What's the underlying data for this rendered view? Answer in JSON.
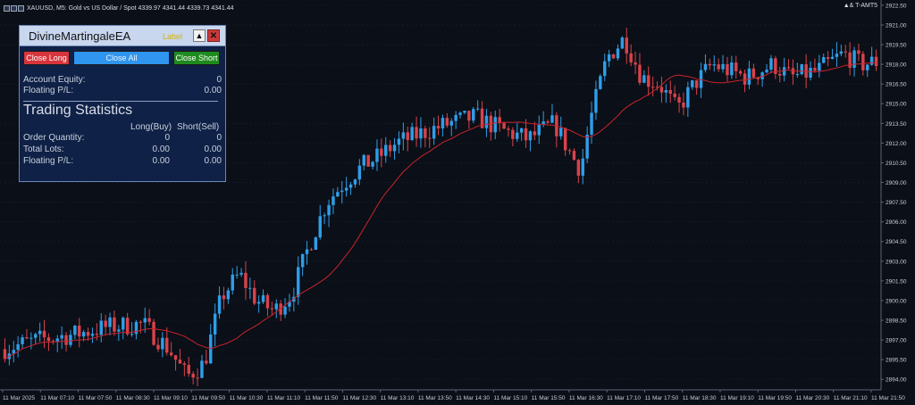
{
  "title_bar": {
    "text": "XAUUSD, M5:  Gold vs US Dollar / Spot  4339.97 4341.44 4339.73 4341.44"
  },
  "top_right_badge": "▲& T-AMT5",
  "colors": {
    "bull": "#2f9ee8",
    "bear": "#d9424b",
    "ma_line": "#c8242c",
    "grid": "#1a2333",
    "background": "#0b0f17"
  },
  "price_axis": {
    "ticks": [
      "2922.50",
      "2921.00",
      "2919.50",
      "2918.00",
      "2916.50",
      "2915.00",
      "2913.50",
      "2912.00",
      "2910.50",
      "2909.00",
      "2907.50",
      "2906.00",
      "2904.50",
      "2903.00",
      "2901.50",
      "2900.00",
      "2898.50",
      "2897.00",
      "2895.50",
      "2894.00"
    ]
  },
  "time_axis": {
    "ticks": [
      "11 Mar 2025",
      "11 Mar 07:10",
      "11 Mar 07:50",
      "11 Mar 08:30",
      "11 Mar 09:10",
      "11 Mar 09:50",
      "11 Mar 10:30",
      "11 Mar 11:10",
      "11 Mar 11:50",
      "11 Mar 12:30",
      "11 Mar 13:10",
      "11 Mar 13:50",
      "11 Mar 14:30",
      "11 Mar 15:10",
      "11 Mar 15:50",
      "11 Mar 16:30",
      "11 Mar 17:10",
      "11 Mar 17:50",
      "11 Mar 18:30",
      "11 Mar 19:10",
      "11 Mar 19:50",
      "11 Mar 20:30",
      "11 Mar 21:10",
      "11 Mar 21:50"
    ]
  },
  "chart_data": {
    "type": "candlestick",
    "x_start": "11 Mar 2025",
    "ylim": [
      2893.2,
      2922.9
    ],
    "control_points": [
      [
        0,
        2896.3
      ],
      [
        8,
        2897.0
      ],
      [
        16,
        2897.4
      ],
      [
        24,
        2898.0
      ],
      [
        32,
        2898.2
      ],
      [
        38,
        2896.3
      ],
      [
        42,
        2894.2
      ],
      [
        46,
        2895.2
      ],
      [
        50,
        2900.3
      ],
      [
        54,
        2902.0
      ],
      [
        58,
        2900.0
      ],
      [
        62,
        2899.2
      ],
      [
        66,
        2900.5
      ],
      [
        70,
        2904.2
      ],
      [
        74,
        2907.5
      ],
      [
        78,
        2909.0
      ],
      [
        82,
        2910.2
      ],
      [
        86,
        2911.0
      ],
      [
        90,
        2912.0
      ],
      [
        96,
        2912.8
      ],
      [
        102,
        2913.5
      ],
      [
        108,
        2914.0
      ],
      [
        114,
        2913.0
      ],
      [
        120,
        2912.3
      ],
      [
        126,
        2913.5
      ],
      [
        130,
        2911.0
      ],
      [
        132,
        2910.0
      ],
      [
        134,
        2913.5
      ],
      [
        138,
        2918.5
      ],
      [
        142,
        2920.0
      ],
      [
        146,
        2917.0
      ],
      [
        150,
        2916.5
      ],
      [
        154,
        2914.5
      ],
      [
        158,
        2916.5
      ],
      [
        162,
        2918.0
      ],
      [
        166,
        2917.5
      ],
      [
        170,
        2917.0
      ],
      [
        176,
        2918.0
      ],
      [
        180,
        2917.0
      ],
      [
        186,
        2917.5
      ],
      [
        192,
        2918.8
      ],
      [
        196,
        2918.0
      ],
      [
        200,
        2918.2
      ]
    ],
    "candle_count": 200
  },
  "ea_panel": {
    "title": "DivineMartingaleEA",
    "label": "Label",
    "minimize_glyph": "▲",
    "close_glyph": "✕",
    "buttons": {
      "close_long": "Close Long",
      "close_all": "Close All",
      "close_short": "Close Short"
    },
    "account_equity": {
      "label": "Account Equity:",
      "value": "0"
    },
    "floating_pl": {
      "label": "Floating P/L:",
      "value": "0.00"
    },
    "stats": {
      "title": "Trading Statistics",
      "col_long": "Long(Buy)",
      "col_short": "Short(Sell)",
      "rows": [
        {
          "label": "Order Quantity:",
          "long": "0",
          "short": "0"
        },
        {
          "label": "Total Lots:",
          "long": "0.00",
          "short": "0.00"
        },
        {
          "label": "Floating P/L:",
          "long": "0.00",
          "short": "0.00"
        }
      ]
    }
  }
}
